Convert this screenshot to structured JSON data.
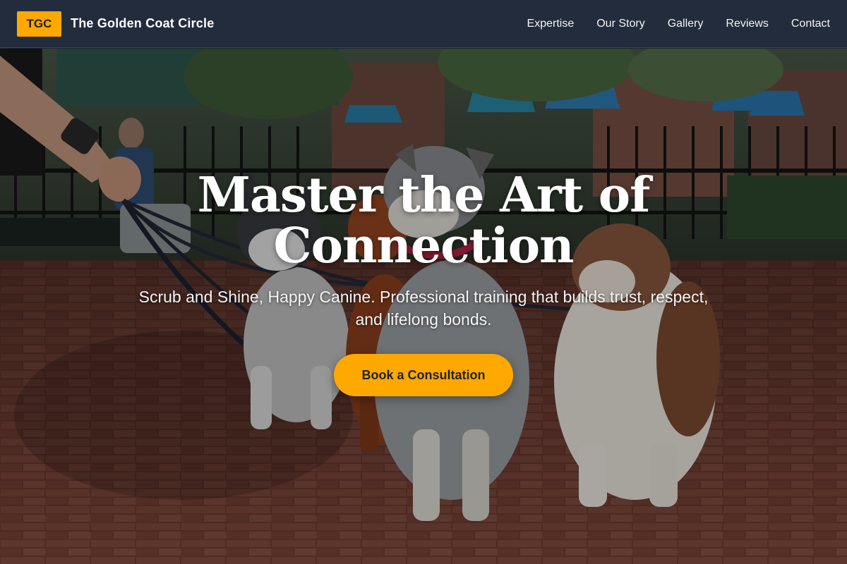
{
  "colors": {
    "accent": "#ffa800",
    "header_bg": "#222c3c",
    "text_light": "#ffffff"
  },
  "header": {
    "logo_text": "TGC",
    "brand_name": "The Golden Coat Circle",
    "nav": [
      {
        "label": "Expertise"
      },
      {
        "label": "Our Story"
      },
      {
        "label": "Gallery"
      },
      {
        "label": "Reviews"
      },
      {
        "label": "Contact"
      }
    ]
  },
  "hero": {
    "title_line1": "Master the Art of",
    "title_line2": "Connection",
    "subtitle": "Scrub and Shine, Happy Canine. Professional training that builds trust, respect, and lifelong bonds.",
    "cta_label": "Book a Consultation"
  }
}
